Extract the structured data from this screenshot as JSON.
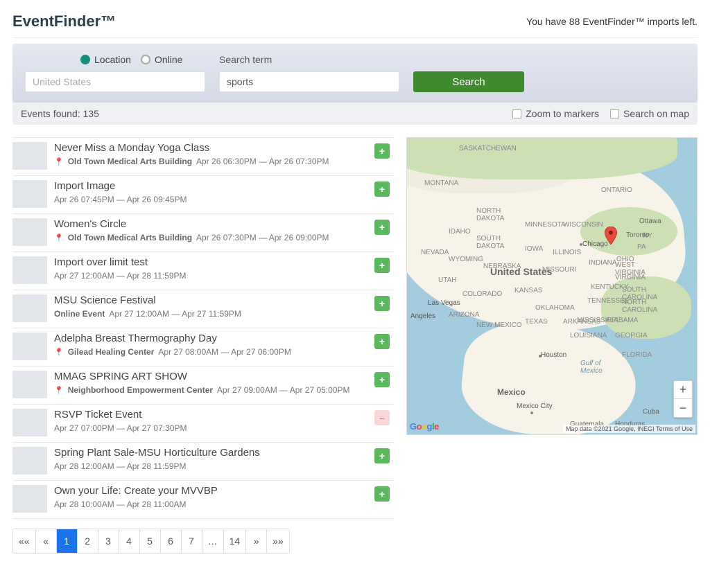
{
  "header": {
    "brand": "EventFinder™",
    "credits": "You have 88 EventFinder™ imports left."
  },
  "search": {
    "radio_location": "Location",
    "radio_online": "Online",
    "term_label": "Search term",
    "location_placeholder": "United States",
    "term_value": "sports",
    "button": "Search"
  },
  "status": {
    "found": "Events found: 135",
    "zoom_markers": "Zoom to markers",
    "search_on_map": "Search on map"
  },
  "events": [
    {
      "title": "Never Miss a Monday Yoga Class",
      "pin": true,
      "venue": "Old Town Medical Arts Building",
      "time": "Apr 26 06:30PM — Apr 26 07:30PM",
      "btn": "+"
    },
    {
      "title": "Import Image",
      "pin": false,
      "venue": "",
      "time": "Apr 26 07:45PM — Apr 26 09:45PM",
      "btn": "+"
    },
    {
      "title": "Women's Circle",
      "pin": true,
      "venue": "Old Town Medical Arts Building",
      "time": "Apr 26 07:30PM — Apr 26 09:00PM",
      "btn": "+"
    },
    {
      "title": "Import over limit test",
      "pin": false,
      "venue": "",
      "time": "Apr 27 12:00AM — Apr 28 11:59PM",
      "btn": "+"
    },
    {
      "title": "MSU Science Festival",
      "pin": false,
      "venue": "Online Event",
      "online": true,
      "time": "Apr 27 12:00AM — Apr 27 11:59PM",
      "btn": "+"
    },
    {
      "title": "Adelpha Breast Thermography Day",
      "pin": true,
      "venue": "Gilead Healing Center",
      "time": "Apr 27 08:00AM — Apr 27 06:00PM",
      "btn": "+"
    },
    {
      "title": "MMAG SPRING ART SHOW",
      "pin": true,
      "venue": "Neighborhood Empowerment Center",
      "time": "Apr 27 09:00AM — Apr 27 05:00PM",
      "btn": "+"
    },
    {
      "title": "RSVP Ticket Event",
      "pin": false,
      "venue": "",
      "time": "Apr 27 07:00PM — Apr 27 07:30PM",
      "btn": "–"
    },
    {
      "title": "Spring Plant Sale-MSU Horticulture Gardens",
      "pin": false,
      "venue": "",
      "time": "Apr 28 12:00AM — Apr 28 11:59PM",
      "btn": "+"
    },
    {
      "title": "Own your Life: Create your MVVBP",
      "pin": false,
      "venue": "",
      "time": "Apr 28 10:00AM — Apr 28 11:00AM",
      "btn": "+"
    }
  ],
  "pagination": [
    "««",
    "«",
    "1",
    "2",
    "3",
    "4",
    "5",
    "6",
    "7",
    "…",
    "14",
    "»",
    "»»"
  ],
  "pagination_active": "1",
  "map": {
    "attr": "Map data ©2021 Google, INEGI   Terms of Use",
    "zoom_in": "+",
    "zoom_out": "−",
    "labels": {
      "us": "United States",
      "mx": "Mexico",
      "gulf": "Gulf of\nMexico"
    }
  }
}
